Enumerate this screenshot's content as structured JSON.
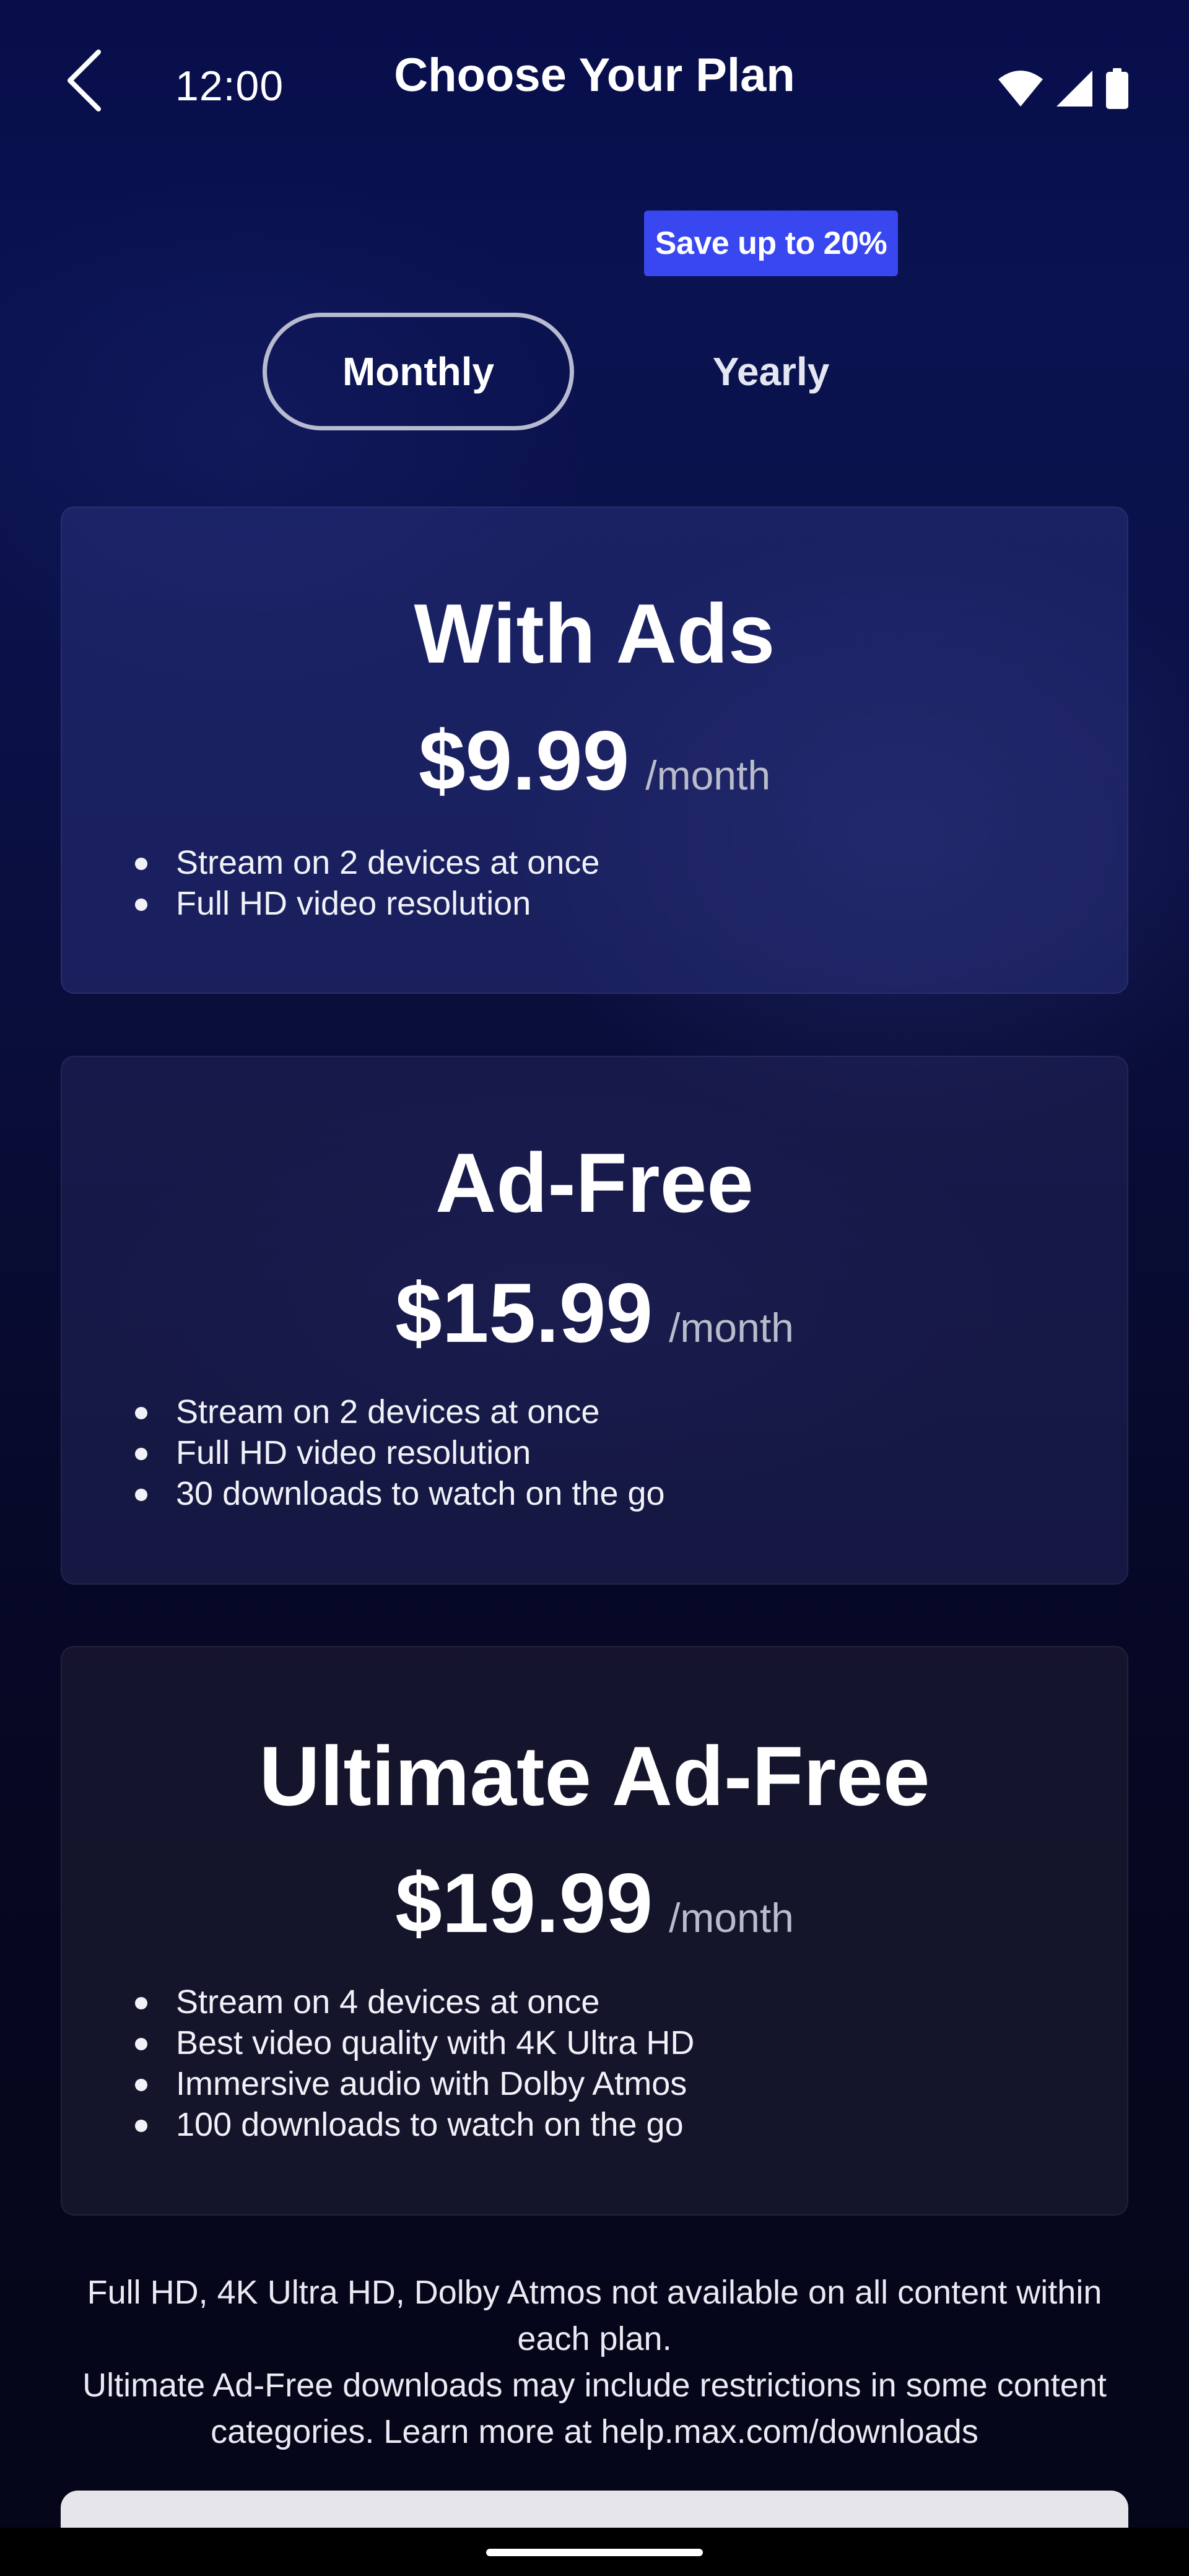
{
  "status_bar": {
    "time": "12:00",
    "icons": [
      "wifi-icon",
      "cellular-signal-icon",
      "battery-icon"
    ]
  },
  "header": {
    "title": "Choose Your Plan",
    "back_icon": "chevron-left-icon"
  },
  "billing_toggle": {
    "badge": "Save up to 20%",
    "options": [
      {
        "label": "Monthly",
        "selected": true
      },
      {
        "label": "Yearly",
        "selected": false
      }
    ]
  },
  "plans": [
    {
      "name": "With Ads",
      "price": "$9.99",
      "period": "/month",
      "features": [
        "Stream on 2 devices at once",
        "Full HD video resolution"
      ]
    },
    {
      "name": "Ad-Free",
      "price": "$15.99",
      "period": "/month",
      "features": [
        "Stream on 2 devices at once",
        "Full HD video resolution",
        "30 downloads to watch on the go"
      ]
    },
    {
      "name": "Ultimate Ad-Free",
      "price": "$19.99",
      "period": "/month",
      "features": [
        "Stream on 4 devices at once",
        "Best video quality with 4K Ultra HD",
        "Immersive audio with Dolby Atmos",
        "100 downloads to watch on the go"
      ]
    }
  ],
  "disclaimer": {
    "line1": "Full HD, 4K Ultra HD, Dolby Atmos not available on all content within each plan.",
    "line2": "Ultimate Ad-Free downloads may include restrictions in some content categories. Learn more at help.max.com/downloads"
  },
  "colors": {
    "background_top": "#070e4a",
    "background_bottom": "#050618",
    "badge": "#3947f0",
    "toggle_border": "#b8bbcf",
    "period_text": "#b9bccb"
  }
}
